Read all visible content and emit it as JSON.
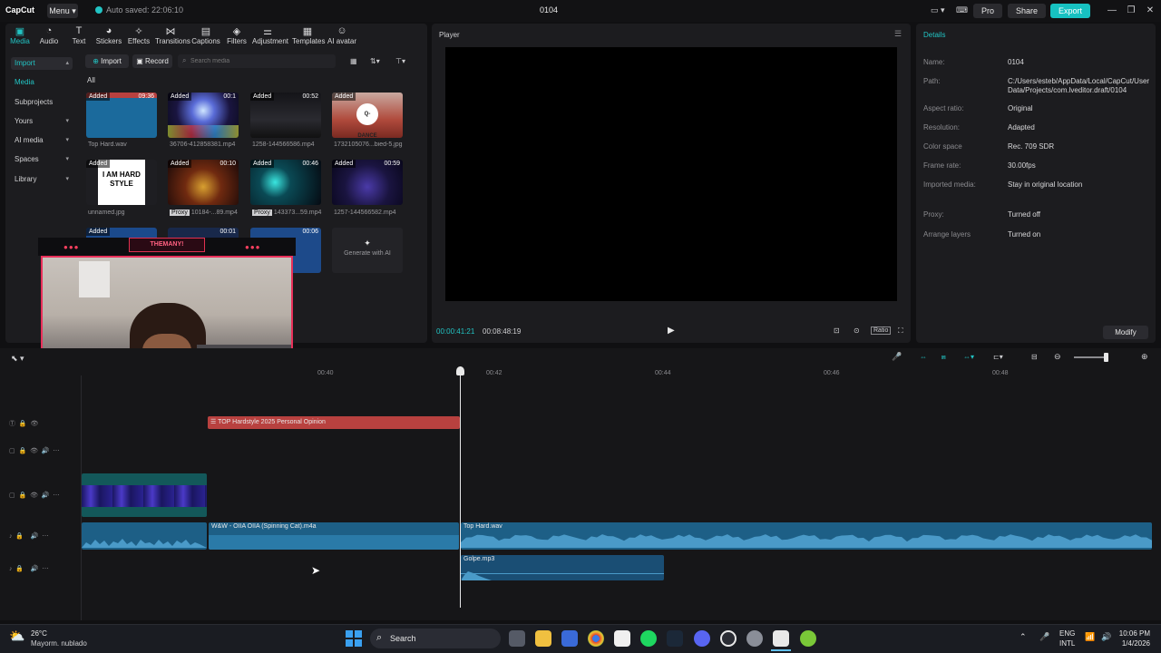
{
  "titlebar": {
    "logo": "CapCut",
    "menu": "Menu",
    "autosave": "Auto saved: 22:06:10",
    "project_title": "0104",
    "pro": "Pro",
    "share": "Share",
    "export": "Export"
  },
  "toolbar": [
    {
      "label": "Media",
      "icon": "media-icon"
    },
    {
      "label": "Audio",
      "icon": "audio-icon"
    },
    {
      "label": "Text",
      "icon": "text-icon"
    },
    {
      "label": "Stickers",
      "icon": "stickers-icon"
    },
    {
      "label": "Effects",
      "icon": "effects-icon"
    },
    {
      "label": "Transitions",
      "icon": "transitions-icon"
    },
    {
      "label": "Captions",
      "icon": "captions-icon"
    },
    {
      "label": "Filters",
      "icon": "filters-icon"
    },
    {
      "label": "Adjustment",
      "icon": "adjustment-icon"
    },
    {
      "label": "Templates",
      "icon": "templates-icon"
    },
    {
      "label": "AI avatar",
      "icon": "ai-avatar-icon"
    }
  ],
  "sidebar": [
    {
      "label": "Import"
    },
    {
      "label": "Media"
    },
    {
      "label": "Subprojects"
    },
    {
      "label": "Yours"
    },
    {
      "label": "AI media"
    },
    {
      "label": "Spaces"
    },
    {
      "label": "Library"
    }
  ],
  "media": {
    "import": "Import",
    "record": "Record",
    "search_placeholder": "Search media",
    "all": "All",
    "added": "Added",
    "generate_ai": "Generate with AI",
    "items": [
      {
        "name": "Top Hard.wav",
        "duration": "09:36"
      },
      {
        "name": "36706-412858381.mp4",
        "duration": "00:1"
      },
      {
        "name": "1258-144566586.mp4",
        "duration": "00:52"
      },
      {
        "name": "1732105076...bied-5.jpg",
        "duration": ""
      },
      {
        "name": "unnamed.jpg",
        "duration": ""
      },
      {
        "name": "10184-...89.mp4",
        "duration": "00:10",
        "proxy": "Proxy"
      },
      {
        "name": "143373...59.mp4",
        "duration": "00:46",
        "proxy": "Proxy"
      },
      {
        "name": "1257-144566582.mp4",
        "duration": "00:59"
      },
      {
        "name": "",
        "duration": "00:01"
      },
      {
        "name": "",
        "duration": "00:06"
      }
    ],
    "hardstyle_text": "I AM HARD STYLE",
    "qdance_text": "Q-DANCE"
  },
  "overlay": {
    "banner": "THEMANY!"
  },
  "player": {
    "title": "Player",
    "current_time": "00:00:41:21",
    "total_time": "00:08:48:19",
    "ratio": "Ratio"
  },
  "details": {
    "title": "Details",
    "rows": [
      {
        "label": "Name:",
        "value": "0104"
      },
      {
        "label": "Path:",
        "value": "C:/Users/esteb/AppData/Local/CapCut/User Data/Projects/com.lveditor.draft/0104"
      },
      {
        "label": "Aspect ratio:",
        "value": "Original"
      },
      {
        "label": "Resolution:",
        "value": "Adapted"
      },
      {
        "label": "Color space",
        "value": "Rec. 709 SDR"
      },
      {
        "label": "Frame rate:",
        "value": "30.00fps"
      },
      {
        "label": "Imported media:",
        "value": "Stay in original location"
      },
      {
        "label": "Proxy:",
        "value": "Turned off"
      },
      {
        "label": "Arrange layers",
        "value": "Turned on"
      }
    ],
    "modify": "Modify"
  },
  "timeline": {
    "ruler": [
      "00:40",
      "00:42",
      "00:44",
      "00:46",
      "00:48"
    ],
    "clips": {
      "text_clip": "TOP Hardstyle 2025 Personal  Opinion",
      "audio1": "W&W - OIIA OIIA (Spinning Cat).m4a",
      "audio2": "Top Hard.wav",
      "audio3": "Golpe.mp3"
    }
  },
  "taskbar": {
    "weather_temp": "26°C",
    "weather_desc": "Mayorm. nublado",
    "search": "Search",
    "lang1": "ENG",
    "lang2": "INTL",
    "time": "10:06 PM",
    "date": "1/4/2026"
  },
  "colors": {
    "accent": "#22c4c4",
    "text_clip": "#b8413f",
    "audio_clip": "#1d5f86",
    "video_clip": "#13585a"
  }
}
